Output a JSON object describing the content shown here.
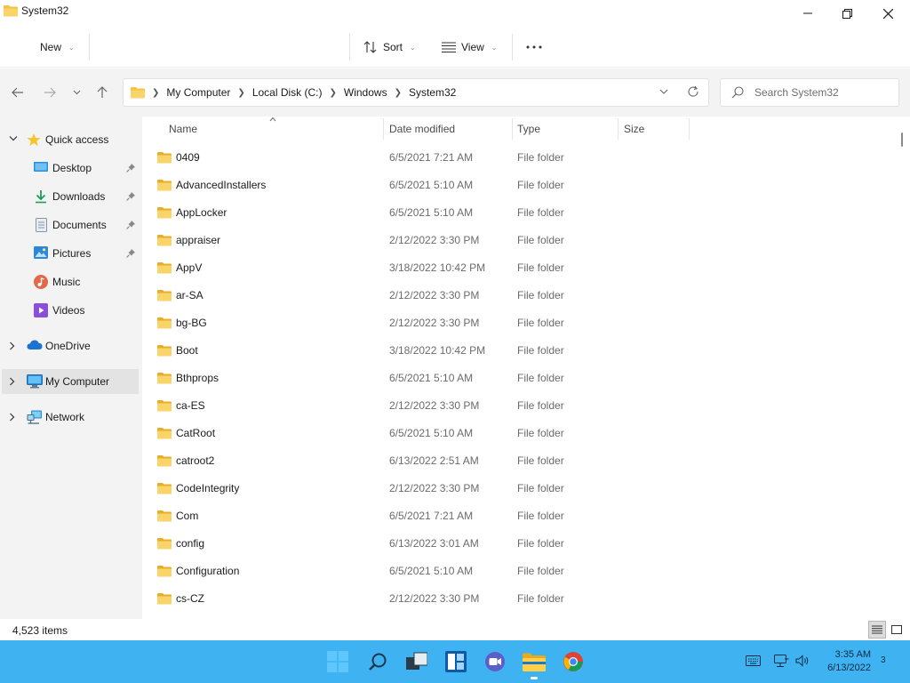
{
  "window": {
    "title": "System32",
    "controls": {
      "minimize": "minimize-icon",
      "maximize": "restore-icon",
      "close": "close-icon"
    }
  },
  "toolbar": {
    "new_label": "New",
    "sort_label": "Sort",
    "view_label": "View",
    "more_icon": "more-icon"
  },
  "address": {
    "crumbs": [
      "My Computer",
      "Local Disk (C:)",
      "Windows",
      "System32"
    ]
  },
  "search": {
    "placeholder": "Search System32"
  },
  "sidebar": {
    "items": [
      {
        "label": "Quick access",
        "icon": "star-icon"
      },
      {
        "label": "Desktop",
        "icon": "desktop-icon",
        "pinned": true
      },
      {
        "label": "Downloads",
        "icon": "download-icon",
        "pinned": true
      },
      {
        "label": "Documents",
        "icon": "documents-icon",
        "pinned": true
      },
      {
        "label": "Pictures",
        "icon": "pictures-icon",
        "pinned": true
      },
      {
        "label": "Music",
        "icon": "music-icon"
      },
      {
        "label": "Videos",
        "icon": "videos-icon"
      },
      {
        "label": "OneDrive",
        "icon": "cloud-icon"
      },
      {
        "label": "My Computer",
        "icon": "computer-icon",
        "selected": true
      },
      {
        "label": "Network",
        "icon": "network-icon"
      }
    ]
  },
  "columns": {
    "name": "Name",
    "date": "Date modified",
    "type": "Type",
    "size": "Size"
  },
  "files": [
    {
      "name": "0409",
      "date": "6/5/2021 7:21 AM",
      "type": "File folder"
    },
    {
      "name": "AdvancedInstallers",
      "date": "6/5/2021 5:10 AM",
      "type": "File folder"
    },
    {
      "name": "AppLocker",
      "date": "6/5/2021 5:10 AM",
      "type": "File folder"
    },
    {
      "name": "appraiser",
      "date": "2/12/2022 3:30 PM",
      "type": "File folder"
    },
    {
      "name": "AppV",
      "date": "3/18/2022 10:42 PM",
      "type": "File folder"
    },
    {
      "name": "ar-SA",
      "date": "2/12/2022 3:30 PM",
      "type": "File folder"
    },
    {
      "name": "bg-BG",
      "date": "2/12/2022 3:30 PM",
      "type": "File folder"
    },
    {
      "name": "Boot",
      "date": "3/18/2022 10:42 PM",
      "type": "File folder"
    },
    {
      "name": "Bthprops",
      "date": "6/5/2021 5:10 AM",
      "type": "File folder"
    },
    {
      "name": "ca-ES",
      "date": "2/12/2022 3:30 PM",
      "type": "File folder"
    },
    {
      "name": "CatRoot",
      "date": "6/5/2021 5:10 AM",
      "type": "File folder"
    },
    {
      "name": "catroot2",
      "date": "6/13/2022 2:51 AM",
      "type": "File folder"
    },
    {
      "name": "CodeIntegrity",
      "date": "2/12/2022 3:30 PM",
      "type": "File folder"
    },
    {
      "name": "Com",
      "date": "6/5/2021 7:21 AM",
      "type": "File folder"
    },
    {
      "name": "config",
      "date": "6/13/2022 3:01 AM",
      "type": "File folder"
    },
    {
      "name": "Configuration",
      "date": "6/5/2021 5:10 AM",
      "type": "File folder"
    },
    {
      "name": "cs-CZ",
      "date": "2/12/2022 3:30 PM",
      "type": "File folder"
    }
  ],
  "status": {
    "item_count": "4,523 items"
  },
  "taskbar": {
    "apps": [
      "start-icon",
      "search-icon",
      "task-view-icon",
      "widgets-icon",
      "chat-icon",
      "file-explorer-icon",
      "chrome-icon"
    ],
    "tray": [
      "keyboard-icon",
      "network-icon",
      "volume-icon"
    ],
    "time": "3:35 AM",
    "date": "6/13/2022",
    "notification_count": "3",
    "color": "#3fb3f2"
  },
  "colors": {
    "folder": "#f5c244",
    "accent": "#0067c0",
    "sidebar_bg": "#f3f3f3",
    "selected_bg": "#e3e3e3"
  }
}
